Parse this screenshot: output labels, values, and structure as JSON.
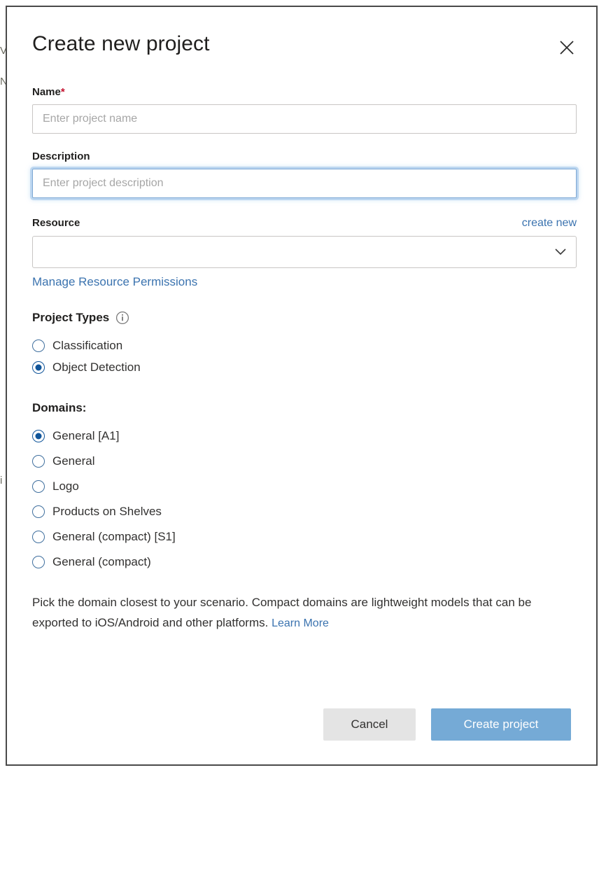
{
  "backdrop": {
    "sliver_1": "V",
    "sliver_2": "N",
    "sliver_3": "i"
  },
  "dialog": {
    "title": "Create new project",
    "close_icon": "close-icon"
  },
  "form": {
    "name": {
      "label": "Name",
      "required_marker": "*",
      "placeholder": "Enter project name",
      "value": ""
    },
    "description": {
      "label": "Description",
      "placeholder": "Enter project description",
      "value": "",
      "focused": true
    },
    "resource": {
      "label": "Resource",
      "create_new_label": "create new",
      "selected_value": "",
      "options": [
        ""
      ],
      "chevron_icon": "chevron-down-icon",
      "manage_permissions_label": "Manage Resource Permissions"
    },
    "project_types": {
      "label": "Project Types",
      "info_icon": "info-icon",
      "options": [
        {
          "label": "Classification",
          "selected": false
        },
        {
          "label": "Object Detection",
          "selected": true
        }
      ]
    },
    "domains": {
      "label": "Domains:",
      "options": [
        {
          "label": "General [A1]",
          "selected": true
        },
        {
          "label": "General",
          "selected": false
        },
        {
          "label": "Logo",
          "selected": false
        },
        {
          "label": "Products on Shelves",
          "selected": false
        },
        {
          "label": "General (compact) [S1]",
          "selected": false
        },
        {
          "label": "General (compact)",
          "selected": false
        }
      ]
    },
    "helper": {
      "text": "Pick the domain closest to your scenario. Compact domains are lightweight models that can be exported to iOS/Android and other platforms.",
      "link_label": "Learn More"
    }
  },
  "footer": {
    "cancel_label": "Cancel",
    "create_label": "Create project"
  },
  "colors": {
    "accent_blue": "#10559a",
    "link_blue": "#3b73af",
    "primary_button": "#75aad6",
    "required_red": "#c4122f",
    "dialog_border": "#4a4a4a"
  }
}
